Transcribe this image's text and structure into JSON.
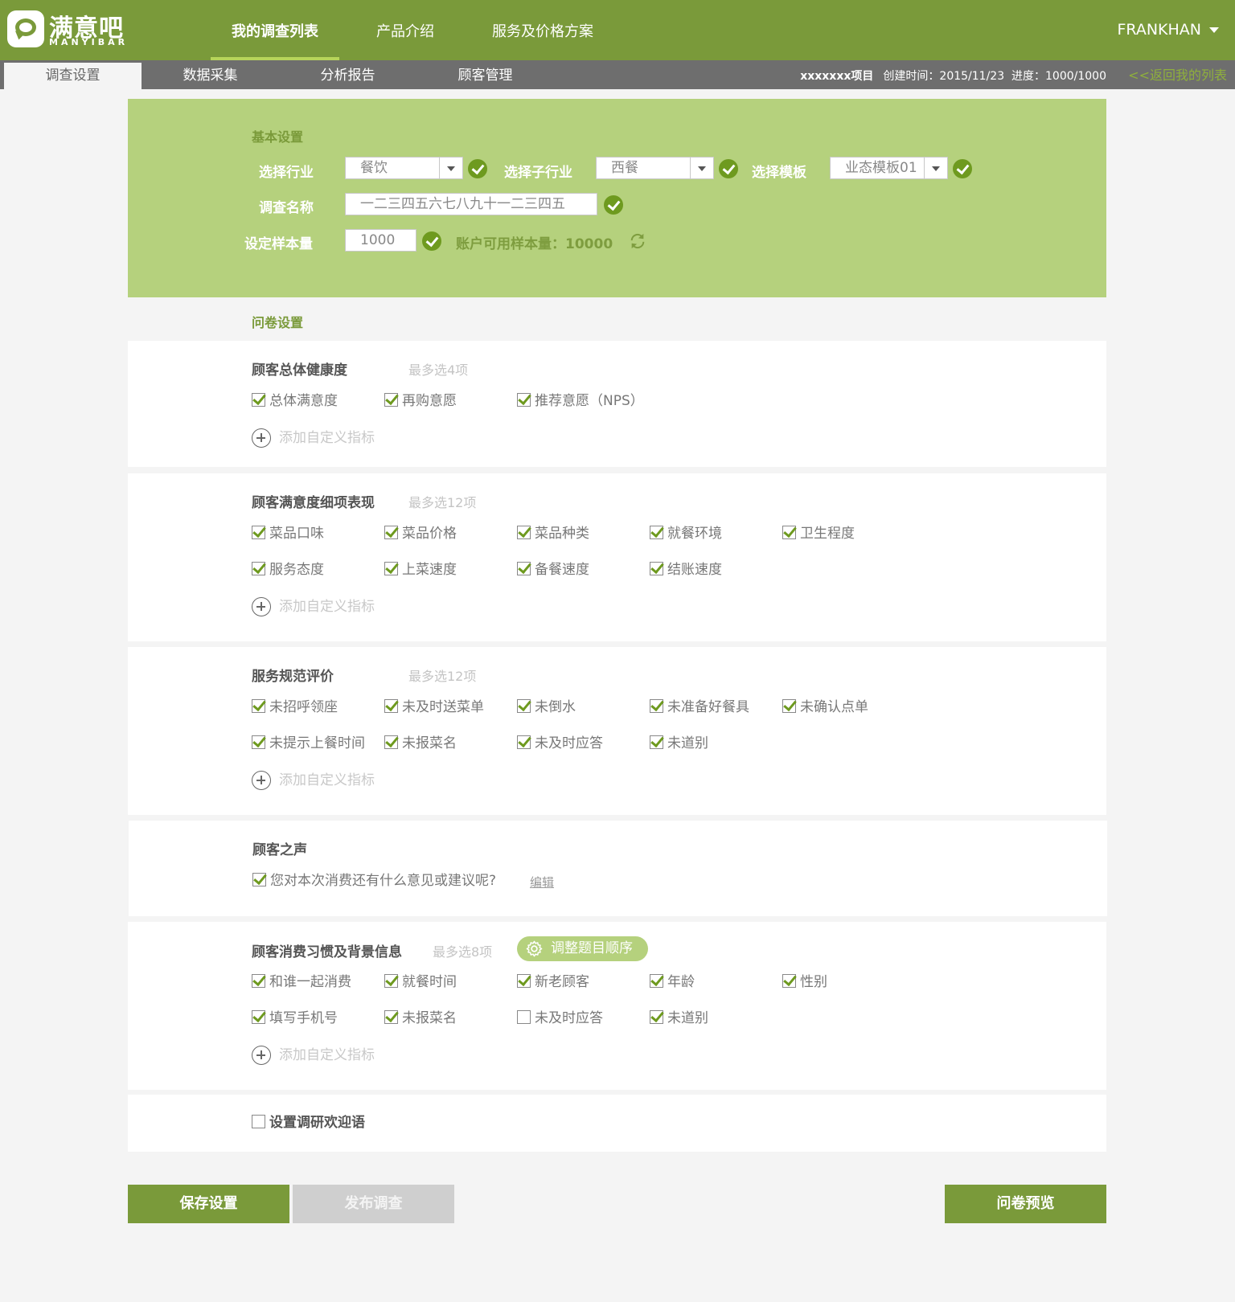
{
  "brand": {
    "name_cn": "满意吧",
    "name_en": "MANYIBAR"
  },
  "main_nav": [
    "我的调查列表",
    "产品介绍",
    "服务及价格方案"
  ],
  "user": {
    "name": "FRANKHAN"
  },
  "sub_tabs": [
    "调查设置",
    "数据采集",
    "分析报告",
    "顾客管理"
  ],
  "project": {
    "name": "xxxxxxx项目",
    "created": "创建时间：2015/11/23",
    "progress": "进度：1000/1000",
    "back_link": "<<返回我的列表"
  },
  "basic": {
    "title": "基本设置",
    "industry_label": "选择行业",
    "industry_value": "餐饮",
    "sub_industry_label": "选择子行业",
    "sub_industry_value": "西餐",
    "template_label": "选择模板",
    "template_value": "业态模板01",
    "name_label": "调查名称",
    "name_value": "一二三四五六七八九十一二三四五",
    "sample_label": "设定样本量",
    "sample_value": "1000",
    "available_label": "账户可用样本量：",
    "available_value": "10000"
  },
  "questionnaire": {
    "title": "问卷设置",
    "add_label": "添加自定义指标",
    "health": {
      "title": "顾客总体健康度",
      "hint": "最多选4项",
      "options": [
        "总体满意度",
        "再购意愿",
        "推荐意愿（NPS）"
      ]
    },
    "detail": {
      "title": "顾客满意度细项表现",
      "hint": "最多选12项",
      "options": [
        "菜品口味",
        "菜品价格",
        "菜品种类",
        "就餐环境",
        "卫生程度",
        "服务态度",
        "上菜速度",
        "备餐速度",
        "结账速度"
      ]
    },
    "service": {
      "title": "服务规范评价",
      "hint": "最多选12项",
      "options": [
        "未招呼领座",
        "未及时送菜单",
        "未倒水",
        "未准备好餐具",
        "未确认点单",
        "未提示上餐时间",
        "未报菜名",
        "未及时应答",
        "未道别"
      ]
    },
    "voice": {
      "title": "顾客之声",
      "question": "您对本次消费还有什么意见或建议呢?",
      "edit": "编辑"
    },
    "habits": {
      "title": "顾客消费习惯及背景信息",
      "hint": "最多选8项",
      "order_button": "调整题目顺序",
      "options": [
        "和谁一起消费",
        "就餐时间",
        "新老顾客",
        "年龄",
        "性别",
        "填写手机号",
        "未报菜名",
        "未及时应答",
        "未道别"
      ],
      "checked": [
        true,
        true,
        true,
        true,
        true,
        true,
        true,
        false,
        true
      ]
    },
    "welcome": {
      "label": "设置调研欢迎语",
      "checked": false
    }
  },
  "buttons": {
    "save": "保存设置",
    "publish": "发布调查",
    "preview": "问卷预览"
  },
  "colors": {
    "brand": "#7a9a3a",
    "panel": "#b5d17d",
    "subbar": "#6e6e6e",
    "check": "#6e9a1f"
  }
}
